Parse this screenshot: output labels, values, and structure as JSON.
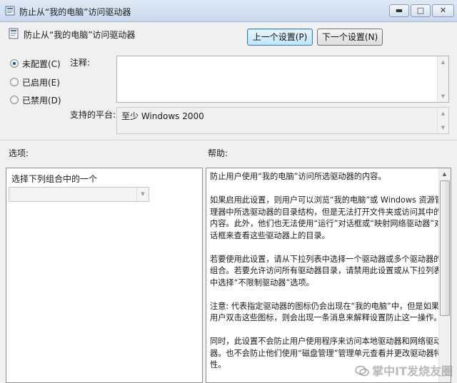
{
  "window": {
    "title": "防止从“我的电脑”访问驱动器",
    "controls": {
      "minimize": "▬",
      "maximize": "□",
      "close": "✕"
    }
  },
  "header": {
    "setting_name": "防止从“我的电脑”访问驱动器",
    "prev_button": "上一个设置(P)",
    "next_button": "下一个设置(N)"
  },
  "state_options": [
    {
      "label": "未配置(C)",
      "checked": true
    },
    {
      "label": "已启用(E)",
      "checked": false
    },
    {
      "label": "已禁用(D)",
      "checked": false
    }
  ],
  "comment": {
    "label": "注释:",
    "value": ""
  },
  "platform": {
    "label": "支持的平台:",
    "value": "至少 Windows 2000"
  },
  "options": {
    "label": "选项:",
    "caption": "选择下列组合中的一个",
    "combo_value": ""
  },
  "help": {
    "label": "帮助:",
    "paragraphs": [
      "防止用户使用“我的电脑”访问所选驱动器的内容。",
      "如果启用此设置，则用户可以浏览“我的电脑”或 Windows 资源管理器中所选驱动器的目录结构，但是无法打开文件夹或访问其中的内容。此外，他们也无法使用“运行”对话框或“映射网络驱动器”对话框来查看这些驱动器上的目录。",
      "若要使用此设置，请从下拉列表中选择一个驱动器或多个驱动器的组合。若要允许访问所有驱动器目录，请禁用此设置或从下拉列表中选择“不限制驱动器”选项。",
      "注意: 代表指定驱动器的图标仍会出现在“我的电脑”中，但是如果用户双击这些图标，则会出现一条消息来解释设置防止这一操作。",
      "同时，此设置不会防止用户使用程序来访问本地驱动器和网络驱动器。也不会防止他们使用“磁盘管理”管理单元查看并更改驱动器特性。"
    ]
  },
  "watermark": {
    "text": "掌中IT发烧友圈"
  },
  "icons": {
    "title_icon": "policy-icon",
    "header_icon": "policy-setting-icon",
    "watermark_icon": "wechat-icon"
  }
}
